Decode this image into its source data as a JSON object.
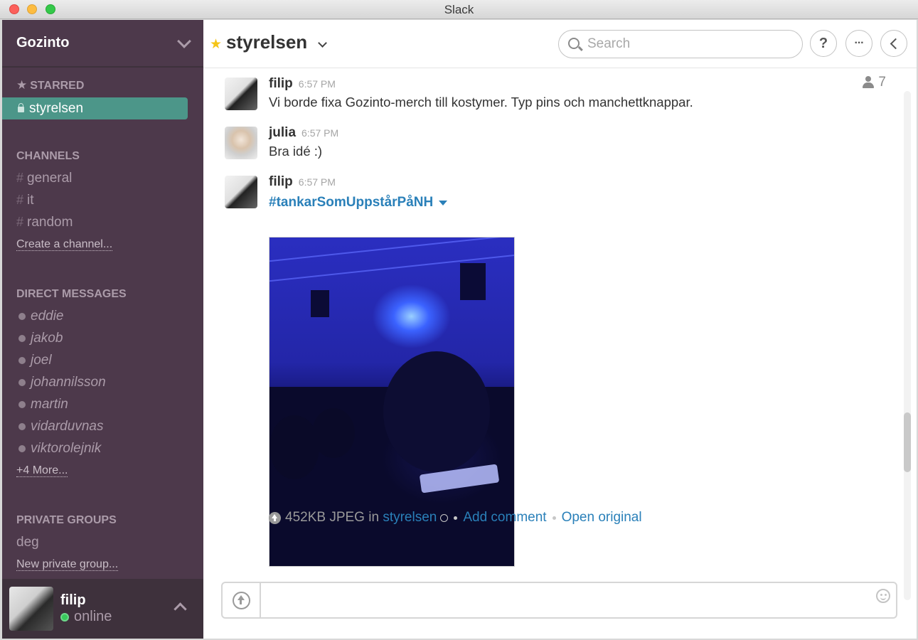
{
  "window": {
    "title": "Slack"
  },
  "sidebar": {
    "team_name": "Gozinto",
    "starred": {
      "title": "STARRED",
      "items": [
        {
          "label": "styrelsen"
        }
      ]
    },
    "channels": {
      "title": "CHANNELS",
      "items": [
        {
          "label": "general"
        },
        {
          "label": "it"
        },
        {
          "label": "random"
        }
      ],
      "create_link": "Create a channel..."
    },
    "direct_messages": {
      "title": "DIRECT MESSAGES",
      "items": [
        {
          "label": "eddie"
        },
        {
          "label": "jakob"
        },
        {
          "label": "joel"
        },
        {
          "label": "johannilsson"
        },
        {
          "label": "martin"
        },
        {
          "label": "vidarduvnas"
        },
        {
          "label": "viktorolejnik"
        }
      ],
      "more_link": "+4 More..."
    },
    "private_groups": {
      "title": "PRIVATE GROUPS",
      "items": [
        {
          "label": "deg"
        }
      ],
      "new_link": "New private group..."
    },
    "me": {
      "name": "filip",
      "status": "online"
    }
  },
  "header": {
    "channel_name": "styrelsen",
    "search_placeholder": "Search",
    "help_label": "?",
    "more_label": "···",
    "member_count": "7"
  },
  "messages": [
    {
      "author": "filip",
      "time": "6:57 PM",
      "text": "Vi borde fixa Gozinto-merch till kostymer. Typ pins och manchettknappar."
    },
    {
      "author": "julia",
      "time": "6:57 PM",
      "text": "Bra idé :)"
    },
    {
      "author": "filip",
      "time": "6:57 PM",
      "file": {
        "title": "#tankarSomUppstårPåNH",
        "size_type": "452KB JPEG",
        "in_word": "in",
        "channel": "styrelsen",
        "add_comment": "Add comment",
        "open_original": "Open original"
      }
    }
  ],
  "composer": {
    "value": ""
  }
}
